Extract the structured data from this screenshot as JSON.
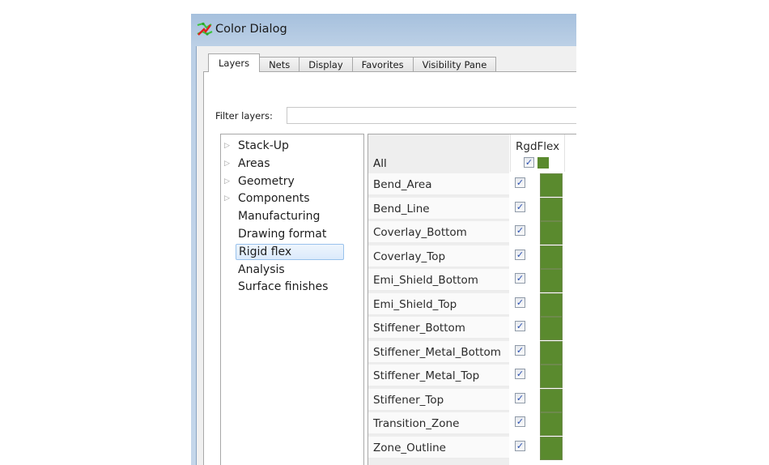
{
  "window": {
    "title": "Color Dialog",
    "icon": "color-dialog-app-icon"
  },
  "tabs": [
    {
      "label": "Layers",
      "active": true
    },
    {
      "label": "Nets",
      "active": false
    },
    {
      "label": "Display",
      "active": false
    },
    {
      "label": "Favorites",
      "active": false
    },
    {
      "label": "Visibility Pane",
      "active": false
    }
  ],
  "filter": {
    "label": "Filter layers:",
    "value": "",
    "placeholder": ""
  },
  "tree": {
    "items": [
      {
        "label": "Stack-Up",
        "expandable": true,
        "selected": false
      },
      {
        "label": "Areas",
        "expandable": true,
        "selected": false
      },
      {
        "label": "Geometry",
        "expandable": true,
        "selected": false
      },
      {
        "label": "Components",
        "expandable": true,
        "selected": false
      },
      {
        "label": "Manufacturing",
        "expandable": false,
        "selected": false
      },
      {
        "label": "Drawing format",
        "expandable": false,
        "selected": false
      },
      {
        "label": "Rigid flex",
        "expandable": false,
        "selected": true
      },
      {
        "label": "Analysis",
        "expandable": false,
        "selected": false
      },
      {
        "label": "Surface finishes",
        "expandable": false,
        "selected": false
      }
    ],
    "expander_glyph": "▷"
  },
  "grid": {
    "all_label": "All",
    "column": {
      "name": "RgdFlex",
      "all_checked": true,
      "all_color": "#5a8a2e"
    },
    "check_glyph": "✓",
    "rows": [
      {
        "name": "Bend_Area",
        "checked": true,
        "color": "#5a8a2e"
      },
      {
        "name": "Bend_Line",
        "checked": true,
        "color": "#5a8a2e"
      },
      {
        "name": "Coverlay_Bottom",
        "checked": true,
        "color": "#5a8a2e"
      },
      {
        "name": "Coverlay_Top",
        "checked": true,
        "color": "#5a8a2e"
      },
      {
        "name": "Emi_Shield_Bottom",
        "checked": true,
        "color": "#5a8a2e"
      },
      {
        "name": "Emi_Shield_Top",
        "checked": true,
        "color": "#5a8a2e"
      },
      {
        "name": "Stiffener_Bottom",
        "checked": true,
        "color": "#5a8a2e"
      },
      {
        "name": "Stiffener_Metal_Bottom",
        "checked": true,
        "color": "#5a8a2e"
      },
      {
        "name": "Stiffener_Metal_Top",
        "checked": true,
        "color": "#5a8a2e"
      },
      {
        "name": "Stiffener_Top",
        "checked": true,
        "color": "#5a8a2e"
      },
      {
        "name": "Transition_Zone",
        "checked": true,
        "color": "#5a8a2e"
      },
      {
        "name": "Zone_Outline",
        "checked": true,
        "color": "#5a8a2e"
      }
    ]
  }
}
